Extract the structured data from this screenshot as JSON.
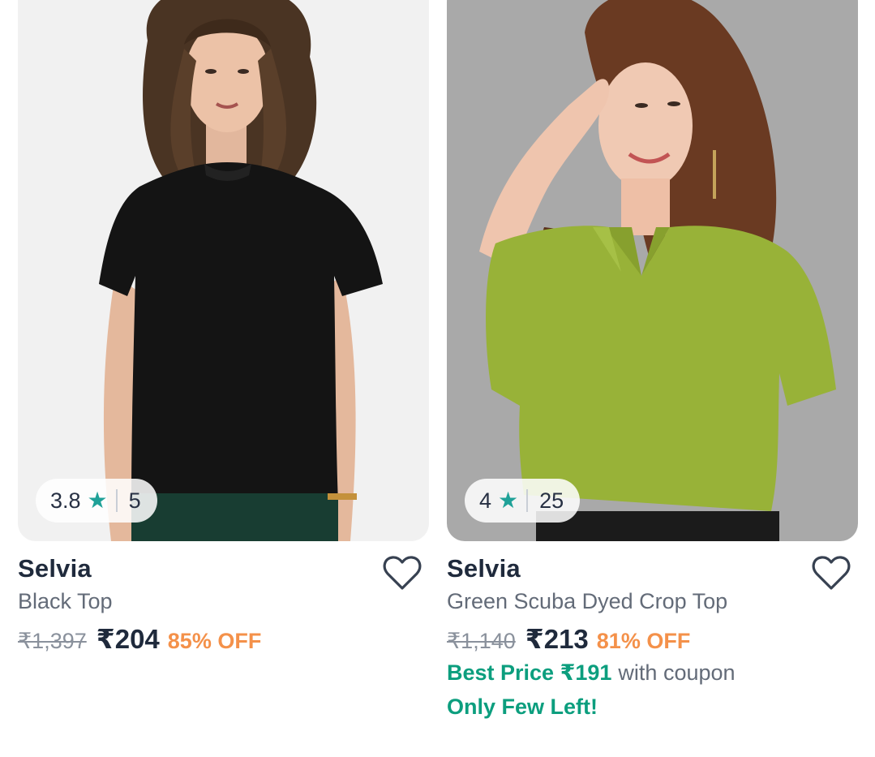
{
  "products": [
    {
      "brand": "Selvia",
      "title": "Black Top",
      "mrp": "₹1,397",
      "price": "₹204",
      "discount": "85% OFF",
      "rating": "3.8",
      "rating_count": "5",
      "image_background": "#f1f1f1",
      "garment_color": "#141414",
      "pants_color": "#183d32"
    },
    {
      "brand": "Selvia",
      "title": "Green Scuba Dyed Crop Top",
      "mrp": "₹1,140",
      "price": "₹213",
      "discount": "81% OFF",
      "rating": "4",
      "rating_count": "25",
      "best_price_label": "Best Price ₹191",
      "coupon_suffix": "with coupon",
      "stock_message": "Only Few Left!",
      "image_background": "#a9a9a9",
      "garment_color": "#98b238"
    }
  ],
  "icons": {
    "star": "star-icon",
    "wishlist": "heart-outline-icon"
  },
  "colors": {
    "rating_star": "#1fa198",
    "discount": "#f4914a",
    "best_price": "#0c9e7e"
  }
}
